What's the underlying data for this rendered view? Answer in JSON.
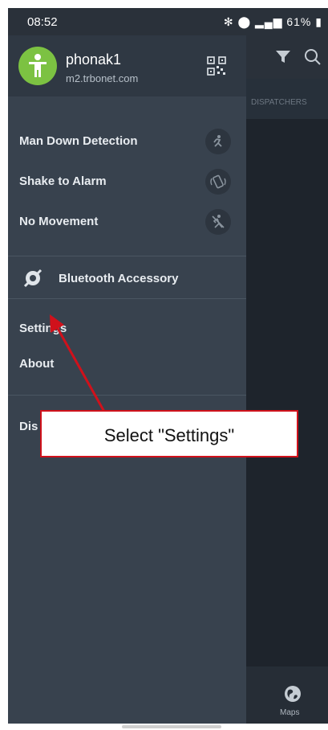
{
  "status_bar": {
    "time": "08:52",
    "battery": "61%"
  },
  "background_app": {
    "tab_label": "DISPATCHERS",
    "bottom_nav_label": "Maps"
  },
  "drawer": {
    "user": {
      "name": "phonak1",
      "server": "m2.trbonet.com"
    },
    "alarms": [
      {
        "label": "Man Down Detection",
        "icon": "man-down-icon"
      },
      {
        "label": "Shake to Alarm",
        "icon": "shake-icon"
      },
      {
        "label": "No Movement",
        "icon": "no-movement-icon"
      }
    ],
    "accessory": {
      "label": "Bluetooth Accessory",
      "icon": "bluetooth-accessory-icon"
    },
    "menu": [
      {
        "label": "Settings"
      },
      {
        "label": "About"
      },
      {
        "label": "Dis"
      }
    ]
  },
  "annotation": {
    "text": "Select \"Settings\"",
    "color": "#d0111b"
  },
  "colors": {
    "avatar": "#7cc242",
    "drawer": "#38424e",
    "status_bar": "#2a313a"
  }
}
